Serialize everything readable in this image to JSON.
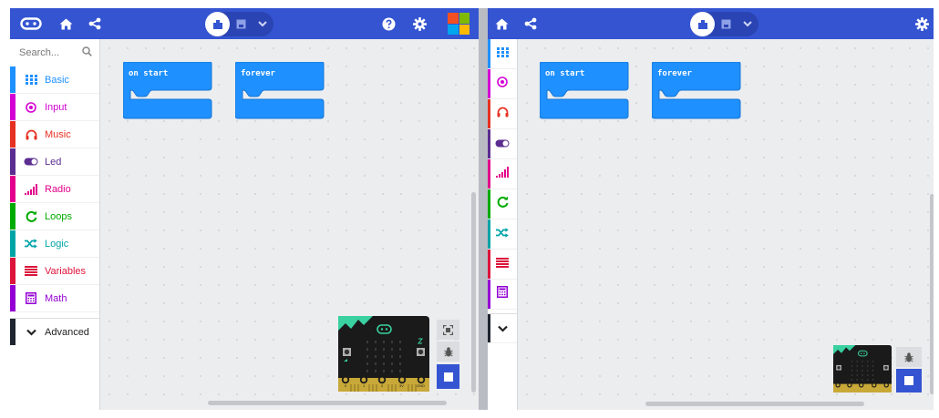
{
  "left": {
    "toolbox": {
      "search_placeholder": "Search...",
      "categories": [
        {
          "label": "Basic",
          "icon": "grid-icon",
          "color": "#1e90ff"
        },
        {
          "label": "Input",
          "icon": "target-icon",
          "color": "#d400d4"
        },
        {
          "label": "Music",
          "icon": "headphones-icon",
          "color": "#e63022"
        },
        {
          "label": "Led",
          "icon": "toggle-icon",
          "color": "#5c2d91"
        },
        {
          "label": "Radio",
          "icon": "signal-bars-icon",
          "color": "#e3008c"
        },
        {
          "label": "Loops",
          "icon": "refresh-icon",
          "color": "#00aa00"
        },
        {
          "label": "Logic",
          "icon": "shuffle-icon",
          "color": "#00a4a6"
        },
        {
          "label": "Variables",
          "icon": "lines-icon",
          "color": "#dc143c"
        },
        {
          "label": "Math",
          "icon": "calculator-icon",
          "color": "#9400d3"
        }
      ],
      "advanced_label": "Advanced"
    },
    "blocks": [
      {
        "label": "on start"
      },
      {
        "label": "forever"
      }
    ]
  },
  "right": {
    "blocks": [
      {
        "label": "on start"
      },
      {
        "label": "forever"
      }
    ]
  },
  "simulator": {
    "pin_labels": [
      "0",
      "1",
      "2",
      "3V",
      "GND"
    ]
  },
  "colors": {
    "topbar": "#3454d1",
    "block": "#1e90ff",
    "advanced": "#1f2630",
    "microbit_accent": "#39d1a0"
  }
}
